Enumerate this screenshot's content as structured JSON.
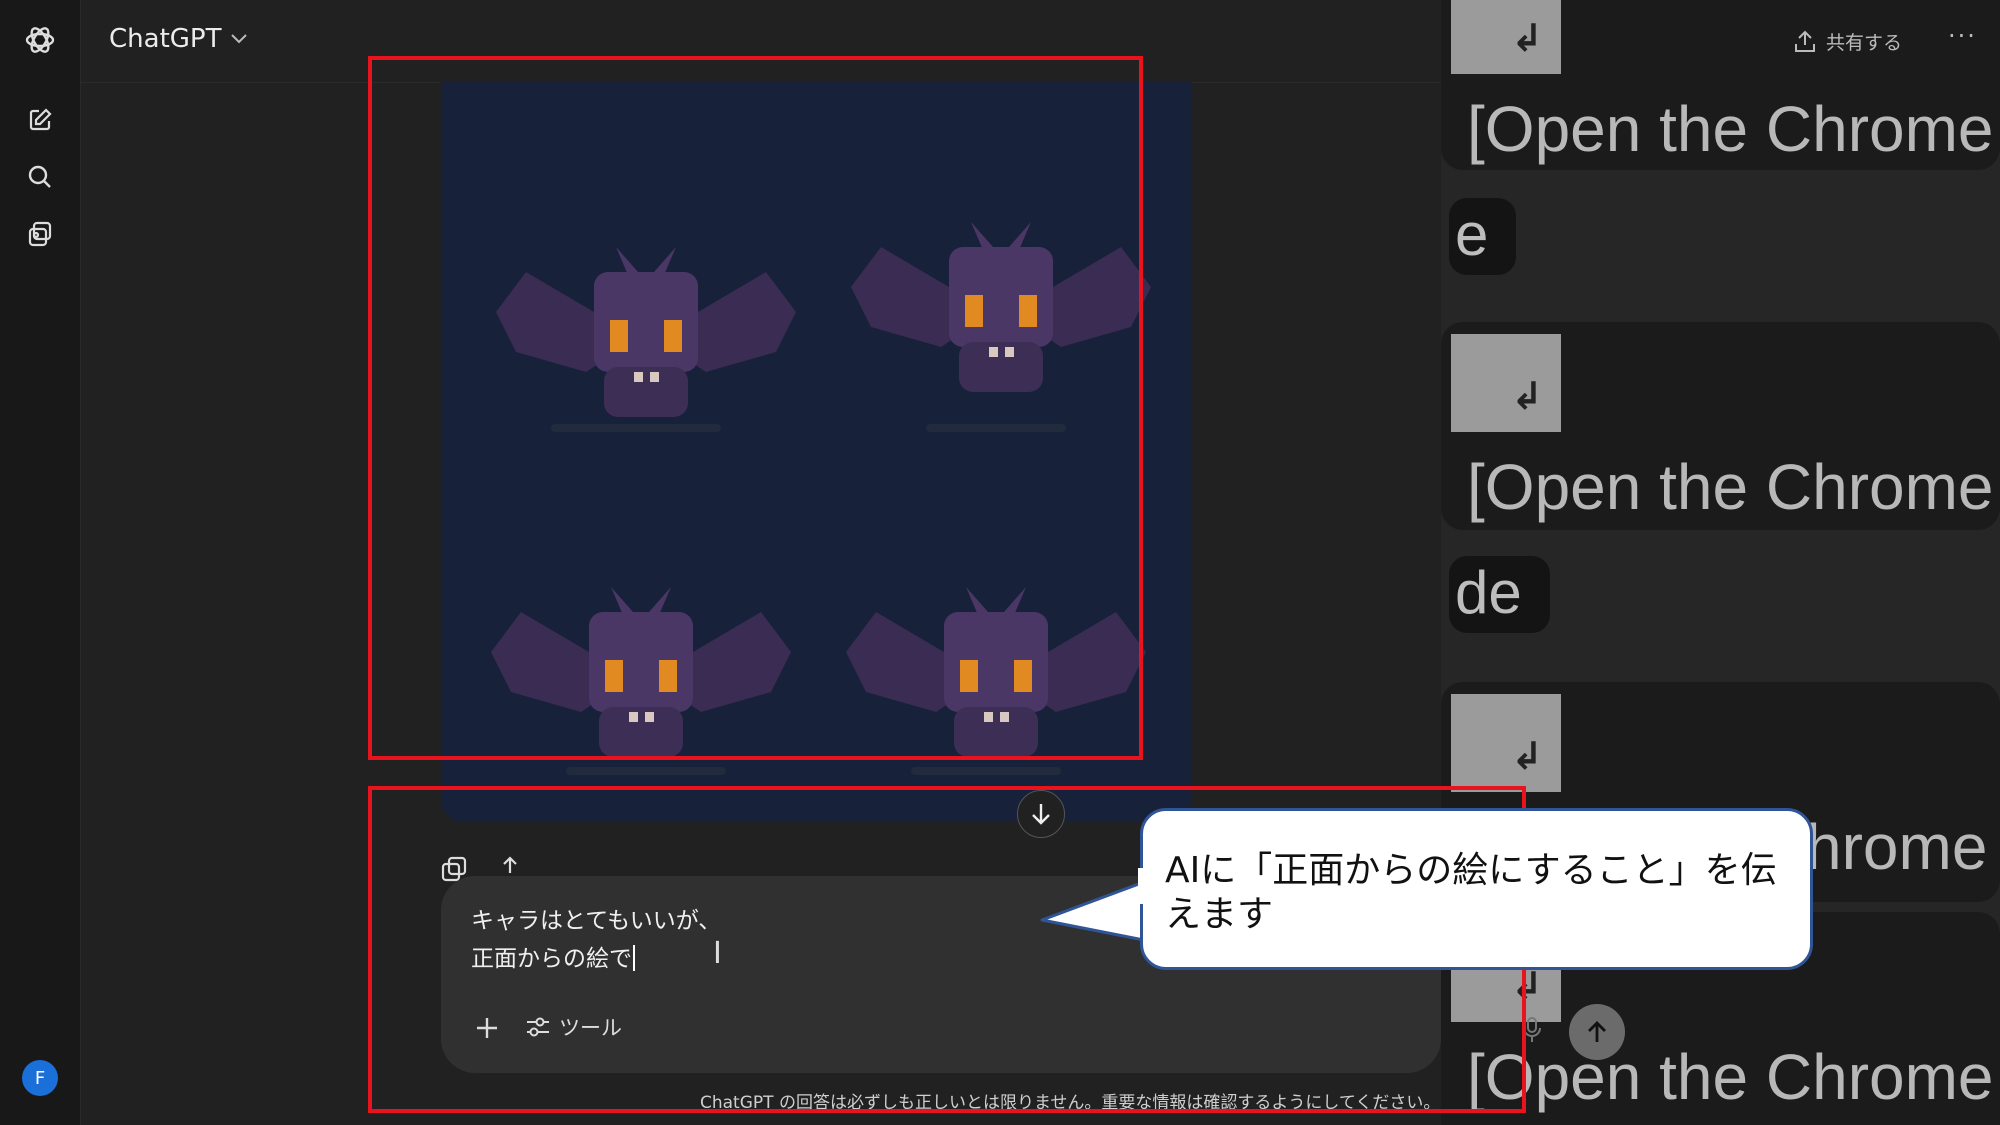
{
  "app": {
    "model_label": "ChatGPT"
  },
  "sidebar": {
    "items": [
      {
        "icon": "new-chat-icon"
      },
      {
        "icon": "search-icon"
      },
      {
        "icon": "library-icon"
      }
    ],
    "avatar_initial": "F"
  },
  "header": {
    "share_label": "共有する",
    "more_label": "···"
  },
  "composer": {
    "text": "キャラはとてもいいが、\n正面からの絵で",
    "tools_label": "ツール",
    "plus_label": "+"
  },
  "footer": {
    "disclaimer": "ChatGPT の回答は必ずしも正しいとは限りません。重要な情報は確認するようにしてください。"
  },
  "callout": {
    "text": "AIに「正面からの絵にすること」を伝えます"
  },
  "overlay": {
    "chrome_line": "[Open the Chrome",
    "chrome_partial": "hrome",
    "fragment_1": "e",
    "fragment_2": "de",
    "enter_symbol": "↲"
  },
  "colors": {
    "highlight": "#e8131c",
    "callout_border": "#2f5597",
    "avatar": "#1a6fd8"
  }
}
